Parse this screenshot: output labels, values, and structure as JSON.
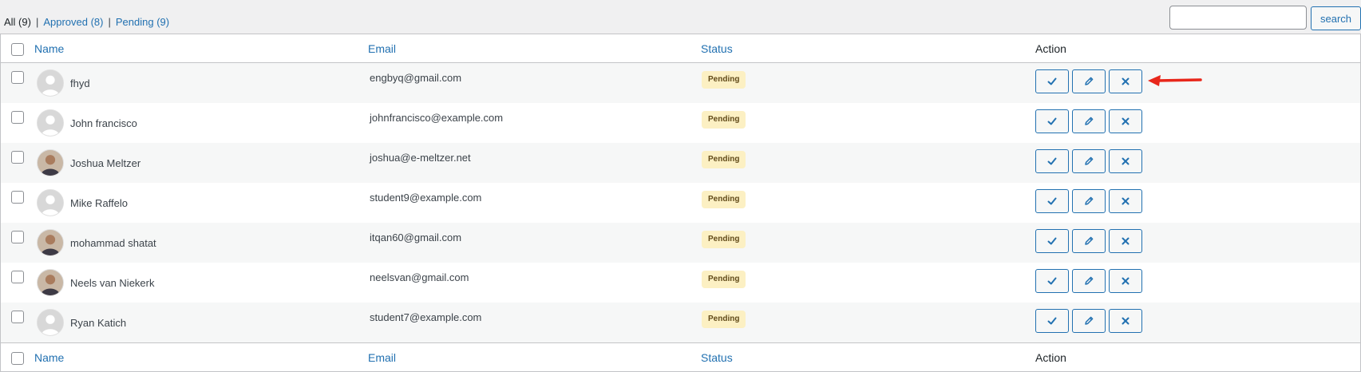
{
  "filters": [
    {
      "label": "All (9)",
      "current": true
    },
    {
      "label": "Approved (8)",
      "current": false
    },
    {
      "label": "Pending (9)",
      "current": false
    }
  ],
  "search": {
    "button_label": "search",
    "placeholder": ""
  },
  "columns": {
    "name": "Name",
    "email": "Email",
    "status": "Status",
    "action": "Action"
  },
  "rows": [
    {
      "name": "fhyd",
      "email": "engbyq@gmail.com",
      "status": "Pending",
      "avatar": "default-avatar-icon"
    },
    {
      "name": "John francisco",
      "email": "johnfrancisco@example.com",
      "status": "Pending",
      "avatar": "default-avatar-icon"
    },
    {
      "name": "Joshua Meltzer",
      "email": "joshua@e-meltzer.net",
      "status": "Pending",
      "avatar": "photo-avatar"
    },
    {
      "name": "Mike Raffelo",
      "email": "student9@example.com",
      "status": "Pending",
      "avatar": "default-avatar-icon"
    },
    {
      "name": "mohammad shatat",
      "email": "itqan60@gmail.com",
      "status": "Pending",
      "avatar": "photo-avatar"
    },
    {
      "name": "Neels van Niekerk",
      "email": "neelsvan@gmail.com",
      "status": "Pending",
      "avatar": "photo-avatar"
    },
    {
      "name": "Ryan Katich",
      "email": "student7@example.com",
      "status": "Pending",
      "avatar": "default-avatar-icon"
    }
  ],
  "row_actions": [
    "approve-check-icon",
    "edit-pencil-icon",
    "reject-x-icon"
  ],
  "colors": {
    "link": "#2271b1",
    "badge_bg": "#fcf0c3",
    "badge_text": "#614a19",
    "annotation_arrow": "#e8271b",
    "row_alt": "#f6f7f7"
  }
}
